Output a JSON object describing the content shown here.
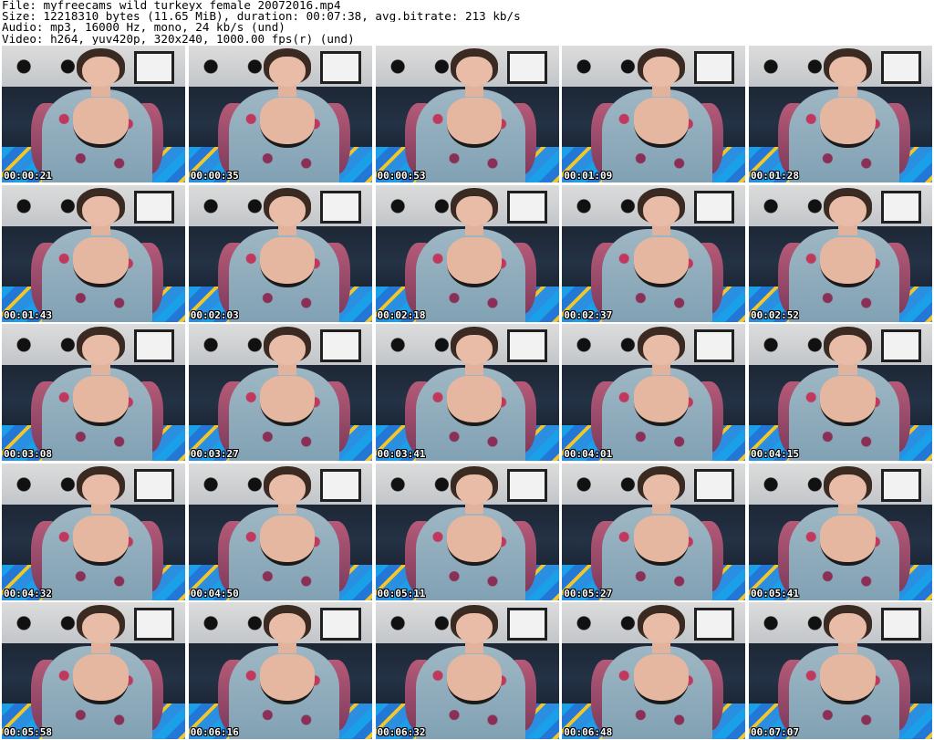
{
  "header": {
    "file_line": "File: myfreecams_wild_turkeyx_female_20072016.mp4",
    "size_line": "Size: 12218310 bytes (11.65 MiB), duration: 00:07:38, avg.bitrate: 213 kb/s",
    "audio_line": "Audio: mp3, 16000 Hz, mono, 24 kb/s (und)",
    "video_line": "Video: h264, yuv420p, 320x240, 1000.00 fps(r) (und)"
  },
  "thumbnails": [
    {
      "timestamp": "00:00:21"
    },
    {
      "timestamp": "00:00:35"
    },
    {
      "timestamp": "00:00:53"
    },
    {
      "timestamp": "00:01:09"
    },
    {
      "timestamp": "00:01:28"
    },
    {
      "timestamp": "00:01:43"
    },
    {
      "timestamp": "00:02:03"
    },
    {
      "timestamp": "00:02:18"
    },
    {
      "timestamp": "00:02:37"
    },
    {
      "timestamp": "00:02:52"
    },
    {
      "timestamp": "00:03:08"
    },
    {
      "timestamp": "00:03:27"
    },
    {
      "timestamp": "00:03:41"
    },
    {
      "timestamp": "00:04:01"
    },
    {
      "timestamp": "00:04:15"
    },
    {
      "timestamp": "00:04:32"
    },
    {
      "timestamp": "00:04:50"
    },
    {
      "timestamp": "00:05:11"
    },
    {
      "timestamp": "00:05:27"
    },
    {
      "timestamp": "00:05:41"
    },
    {
      "timestamp": "00:05:58"
    },
    {
      "timestamp": "00:06:16"
    },
    {
      "timestamp": "00:06:32"
    },
    {
      "timestamp": "00:06:48"
    },
    {
      "timestamp": "00:07:07"
    }
  ]
}
